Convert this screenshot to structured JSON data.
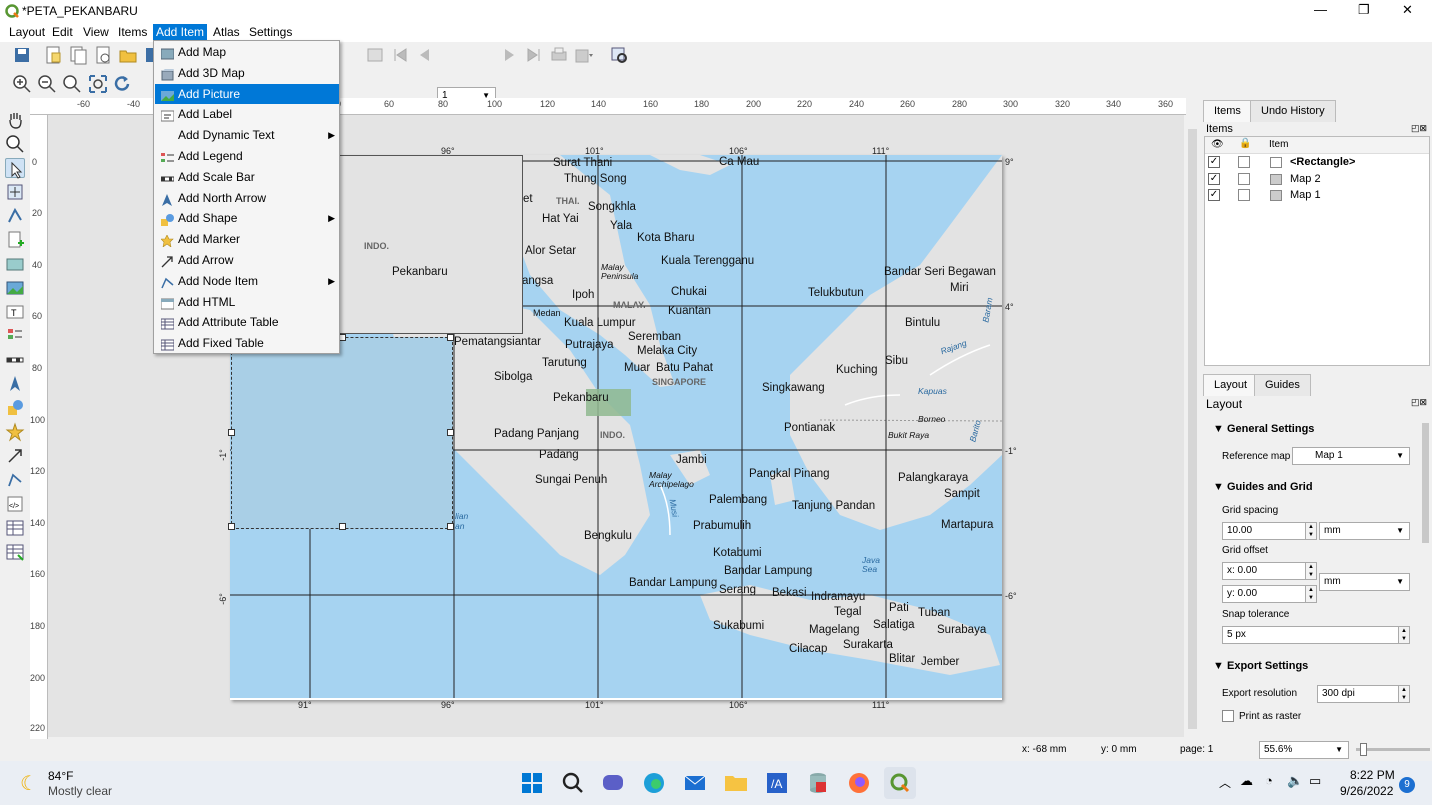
{
  "window": {
    "title": "*PETA_PEKANBARU",
    "controls": [
      "—",
      "❐",
      "✕"
    ]
  },
  "menubar": [
    "Layout",
    "Edit",
    "View",
    "Items",
    "Add Item",
    "Atlas",
    "Settings"
  ],
  "toolbar": {
    "page_value": "1"
  },
  "add_item_menu": [
    {
      "label": "Add Map",
      "icon": "map-icon",
      "submenu": false,
      "highlighted": false
    },
    {
      "label": "Add 3D Map",
      "icon": "3d-map-icon",
      "submenu": false,
      "highlighted": false
    },
    {
      "label": "Add Picture",
      "icon": "picture-icon",
      "submenu": false,
      "highlighted": true
    },
    {
      "label": "Add Label",
      "icon": "label-icon",
      "submenu": false,
      "highlighted": false
    },
    {
      "label": "Add Dynamic Text",
      "icon": "",
      "submenu": true,
      "highlighted": false
    },
    {
      "label": "Add Legend",
      "icon": "legend-icon",
      "submenu": false,
      "highlighted": false
    },
    {
      "label": "Add Scale Bar",
      "icon": "scale-bar-icon",
      "submenu": false,
      "highlighted": false
    },
    {
      "label": "Add North Arrow",
      "icon": "north-arrow-icon",
      "submenu": false,
      "highlighted": false
    },
    {
      "label": "Add Shape",
      "icon": "shape-icon",
      "submenu": true,
      "highlighted": false
    },
    {
      "label": "Add Marker",
      "icon": "marker-icon",
      "submenu": false,
      "highlighted": false
    },
    {
      "label": "Add Arrow",
      "icon": "arrow-icon",
      "submenu": false,
      "highlighted": false
    },
    {
      "label": "Add Node Item",
      "icon": "node-item-icon",
      "submenu": true,
      "highlighted": false
    },
    {
      "label": "Add HTML",
      "icon": "html-icon",
      "submenu": false,
      "highlighted": false
    },
    {
      "label": "Add Attribute Table",
      "icon": "attribute-table-icon",
      "submenu": false,
      "highlighted": false
    },
    {
      "label": "Add Fixed Table",
      "icon": "fixed-table-icon",
      "submenu": false,
      "highlighted": false
    }
  ],
  "ruler": {
    "top": [
      "-60",
      "-40",
      "40",
      "60",
      "80",
      "100",
      "120",
      "140",
      "160",
      "180",
      "200",
      "220",
      "240",
      "260",
      "280",
      "300",
      "320",
      "340",
      "360"
    ],
    "left": [
      "0",
      "20",
      "40",
      "60",
      "80",
      "100",
      "120",
      "140",
      "160",
      "180",
      "200",
      "220"
    ]
  },
  "map": {
    "lon_top": [
      "96°",
      "101°",
      "106°",
      "111°"
    ],
    "lon_bottom": [
      "91°",
      "96°",
      "101°",
      "106°",
      "111°"
    ],
    "lat_right": [
      "9°",
      "4°",
      "-1°",
      "-6°"
    ],
    "lat_left": [
      "-1°",
      "-6°"
    ],
    "places": [
      "Surat Thani",
      "Thung Song",
      "Ca Mau",
      "Songkhla",
      "Hat Yai",
      "Yala",
      "Kota Bharu",
      "Alor Setar",
      "Kuala Terengganu",
      "Bandar Seri Begawan",
      "Miri",
      "angsa",
      "Ipoh",
      "Chukai",
      "Telukbutun",
      "Medan",
      "Kuantan",
      "Kuala Lumpur",
      "Bintulu",
      "Pematangsiantar",
      "Seremban",
      "Putrajaya",
      "Melaka City",
      "Tarutung",
      "Muar",
      "Batu Pahat",
      "Sibu",
      "Kuching",
      "Sibolga",
      "Singkawang",
      "Pekanbaru",
      "Pontianak",
      "Padang Panjang",
      "Padang",
      "Jambi",
      "Pangkal Pinang",
      "Palangkaraya",
      "Sungai Penuh",
      "Sampit",
      "Palembang",
      "Tanjung Pandan",
      "Prabumulih",
      "Martapura",
      "Bengkulu",
      "Kotabumi",
      "Bandar Lampung",
      "Bandar Lampung",
      "Serang",
      "Bekasi",
      "Indramayu",
      "Pati",
      "Tegal",
      "Tuban",
      "Sukabumi",
      "Salatiga",
      "Magelang",
      "Surabaya",
      "Surakarta",
      "Cilacap",
      "Blitar",
      "Jember",
      "et"
    ],
    "countries": [
      "THAI.",
      "MALAY.",
      "SINGAPORE",
      "INDO."
    ],
    "features": [
      "Malay Peninsula",
      "Malay Archipelago",
      "Kapuas",
      "Borneo",
      "Bukit Raya",
      "Java Sea",
      "Musi",
      "Barito",
      "Baram",
      "Rajang",
      "lian",
      "an"
    ],
    "inset_country": "INDO.",
    "inset_place": "Pekanbaru"
  },
  "items_panel": {
    "tabs": [
      "Items",
      "Undo History"
    ],
    "title": "Items",
    "header": "Item",
    "rows": [
      {
        "name": "<Rectangle>",
        "visible": "✓",
        "bold": true
      },
      {
        "name": "Map 2",
        "visible": "✓",
        "bold": false
      },
      {
        "name": "Map 1",
        "visible": "✓",
        "bold": false
      }
    ]
  },
  "layout_panel": {
    "tabs": [
      "Layout",
      "Guides"
    ],
    "title": "Layout",
    "general_settings": "General Settings",
    "reference_map_label": "Reference map",
    "reference_map_value": "Map 1",
    "guides_grid": "Guides and Grid",
    "grid_spacing_label": "Grid spacing",
    "grid_spacing_value": "10.00",
    "grid_spacing_unit": "mm",
    "grid_offset_label": "Grid offset",
    "offset_x": "x: 0.00",
    "offset_y": "y: 0.00",
    "offset_unit": "mm",
    "snap_label": "Snap tolerance",
    "snap_value": "5 px",
    "export_settings": "Export Settings",
    "export_res_label": "Export resolution",
    "export_res_value": "300 dpi",
    "print_raster": "Print as raster"
  },
  "status": {
    "x": "x: -68 mm",
    "y": "y: 0 mm",
    "page": "page: 1",
    "zoom": "55.6%"
  },
  "taskbar": {
    "weather_temp": "84°F",
    "weather_desc": "Mostly clear",
    "time": "8:22 PM",
    "date": "9/26/2022",
    "notifications": "9"
  },
  "colors": {
    "accent": "#0078d7",
    "sea": "#a6d3f1",
    "land": "#e3e3e3",
    "highlight_square": "#8fb88f"
  }
}
